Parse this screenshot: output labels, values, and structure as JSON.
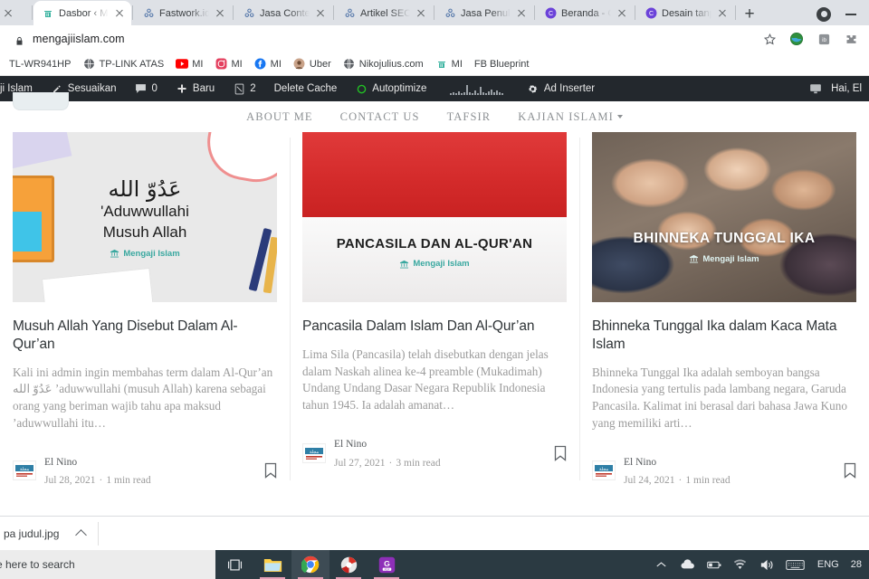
{
  "browser": {
    "tabs": [
      {
        "title": "",
        "favicon": "generic-icon",
        "active": true,
        "partial": true
      },
      {
        "title": "Dasbor ‹ Men",
        "favicon": "wordpress-icon",
        "active": false
      },
      {
        "title": "Fastwork.id: S",
        "favicon": "fastwork-icon",
        "active": false
      },
      {
        "title": "Jasa Content",
        "favicon": "fastwork-icon",
        "active": false
      },
      {
        "title": "Artikel SEO M",
        "favicon": "fastwork-icon",
        "active": false
      },
      {
        "title": "Jasa Penulis A",
        "favicon": "fastwork-icon",
        "active": false
      },
      {
        "title": "Beranda - Ca",
        "favicon": "canva-icon",
        "active": false
      },
      {
        "title": "Desain tanpa",
        "favicon": "canva-icon",
        "active": false
      }
    ],
    "new_tab_label": "+",
    "address": {
      "url": "mengajiislam.com",
      "security_icon": "lock-icon"
    },
    "toolbar_icons": [
      "star-icon",
      "globe-extension-icon",
      "extension-icon",
      "puzzle-icon"
    ],
    "bookmarks": [
      {
        "label": "TL-WR941HP",
        "icon": "router-icon"
      },
      {
        "label": "TP-LINK ATAS",
        "icon": "globe-icon"
      },
      {
        "label": "MI",
        "icon": "youtube-icon"
      },
      {
        "label": "MI",
        "icon": "instagram-icon"
      },
      {
        "label": "MI",
        "icon": "facebook-icon"
      },
      {
        "label": "Uber",
        "icon": "uber-icon"
      },
      {
        "label": "Nikojulius.com",
        "icon": "globe-icon"
      },
      {
        "label": "MI",
        "icon": "wordpress-icon"
      },
      {
        "label": "FB Blueprint",
        "icon": "none"
      }
    ]
  },
  "adminbar": {
    "site_name": "ji Islam",
    "items": [
      {
        "label": "Sesuaikan",
        "icon": "pencil-icon"
      },
      {
        "label": "0",
        "icon": "comment-icon"
      },
      {
        "label": "Baru",
        "icon": "plus-icon"
      },
      {
        "label": "2",
        "icon": "wpforms-icon"
      },
      {
        "label": "Delete Cache",
        "icon": "none"
      },
      {
        "label": "Autoptimize",
        "icon": "circle-icon"
      },
      {
        "label": "",
        "icon": "sparkline-icon"
      },
      {
        "label": "Ad Inserter",
        "icon": "gear-icon"
      }
    ],
    "account": {
      "label": "Hai, El",
      "icon": "screen-icon"
    }
  },
  "site": {
    "nav": [
      {
        "label": "ABOUT ME",
        "has_caret": false
      },
      {
        "label": "CONTACT US",
        "has_caret": false
      },
      {
        "label": "TAFSIR",
        "has_caret": false
      },
      {
        "label": "KAJIAN ISLAMI",
        "has_caret": true
      }
    ],
    "brand_name": "Mengaji Islam",
    "cards": [
      {
        "image": {
          "kind": "arabic-card",
          "arabic": "عَدُوّ الله",
          "line1": "'Aduwwullahi",
          "line2": "Musuh Allah",
          "brand": "Mengaji Islam"
        },
        "title": "Musuh Allah Yang Disebut Dalam Al-Qur’an",
        "excerpt": "Kali ini admin ingin membahas term dalam Al-Qur’an عَدُوّ الله ’aduwwullahi (musuh Allah) karena sebagai orang yang beriman wajib tahu apa maksud ’aduwwullahi itu…",
        "author": "El Nino",
        "date": "Jul 28, 2021",
        "separator": "·",
        "read_time": "1 min read",
        "bookmark_icon": "bookmark-icon"
      },
      {
        "image": {
          "kind": "flag-card",
          "caption": "PANCASILA DAN AL-QUR'AN",
          "brand": "Mengaji Islam"
        },
        "title": "Pancasila Dalam Islam Dan Al-Qur’an",
        "excerpt": "Lima Sila (Pancasila) telah disebutkan dengan jelas dalam Naskah alinea ke-4 preamble (Mukadimah) Undang Undang Dasar Negara Republik Indonesia tahun 1945. Ia adalah amanat…",
        "author": "El Nino",
        "date": "Jul 27, 2021",
        "separator": "·",
        "read_time": "3 min read",
        "bookmark_icon": "bookmark-icon"
      },
      {
        "image": {
          "kind": "hands-card",
          "caption": "BHINNEKA TUNGGAL IKA",
          "brand": "Mengaji Islam"
        },
        "title": "Bhinneka Tunggal Ika dalam Kaca Mata Islam",
        "excerpt": "Bhinneka Tunggal Ika adalah semboyan bangsa Indonesia yang tertulis pada lambang negara, Garuda Pancasila. Kalimat ini berasal dari bahasa Jawa Kuno yang memiliki arti…",
        "author": "El Nino",
        "date": "Jul 24, 2021",
        "separator": "·",
        "read_time": "1 min read",
        "bookmark_icon": "bookmark-icon"
      }
    ]
  },
  "download_bar": {
    "filename": "pa judul.jpg",
    "menu_icon": "chevron-up-icon"
  },
  "taskbar": {
    "search_placeholder": "e here to search",
    "apps": [
      {
        "name": "task-view-icon"
      },
      {
        "name": "file-explorer-icon"
      },
      {
        "name": "chrome-icon"
      },
      {
        "name": "media-app-icon"
      },
      {
        "name": "pdf-app-icon"
      }
    ],
    "tray": [
      "show-hidden-icon",
      "cloud-icon",
      "battery-icon",
      "wifi-icon",
      "volume-icon",
      "keyboard-icon"
    ],
    "language": "ENG",
    "clock": "28"
  },
  "colors": {
    "chrome_tabstrip": "#dee1e6",
    "admin_bar": "#23282d",
    "taskbar": "#2b3a42",
    "brand_teal": "#3aa8a0",
    "flag_red": "#d42b2b"
  }
}
